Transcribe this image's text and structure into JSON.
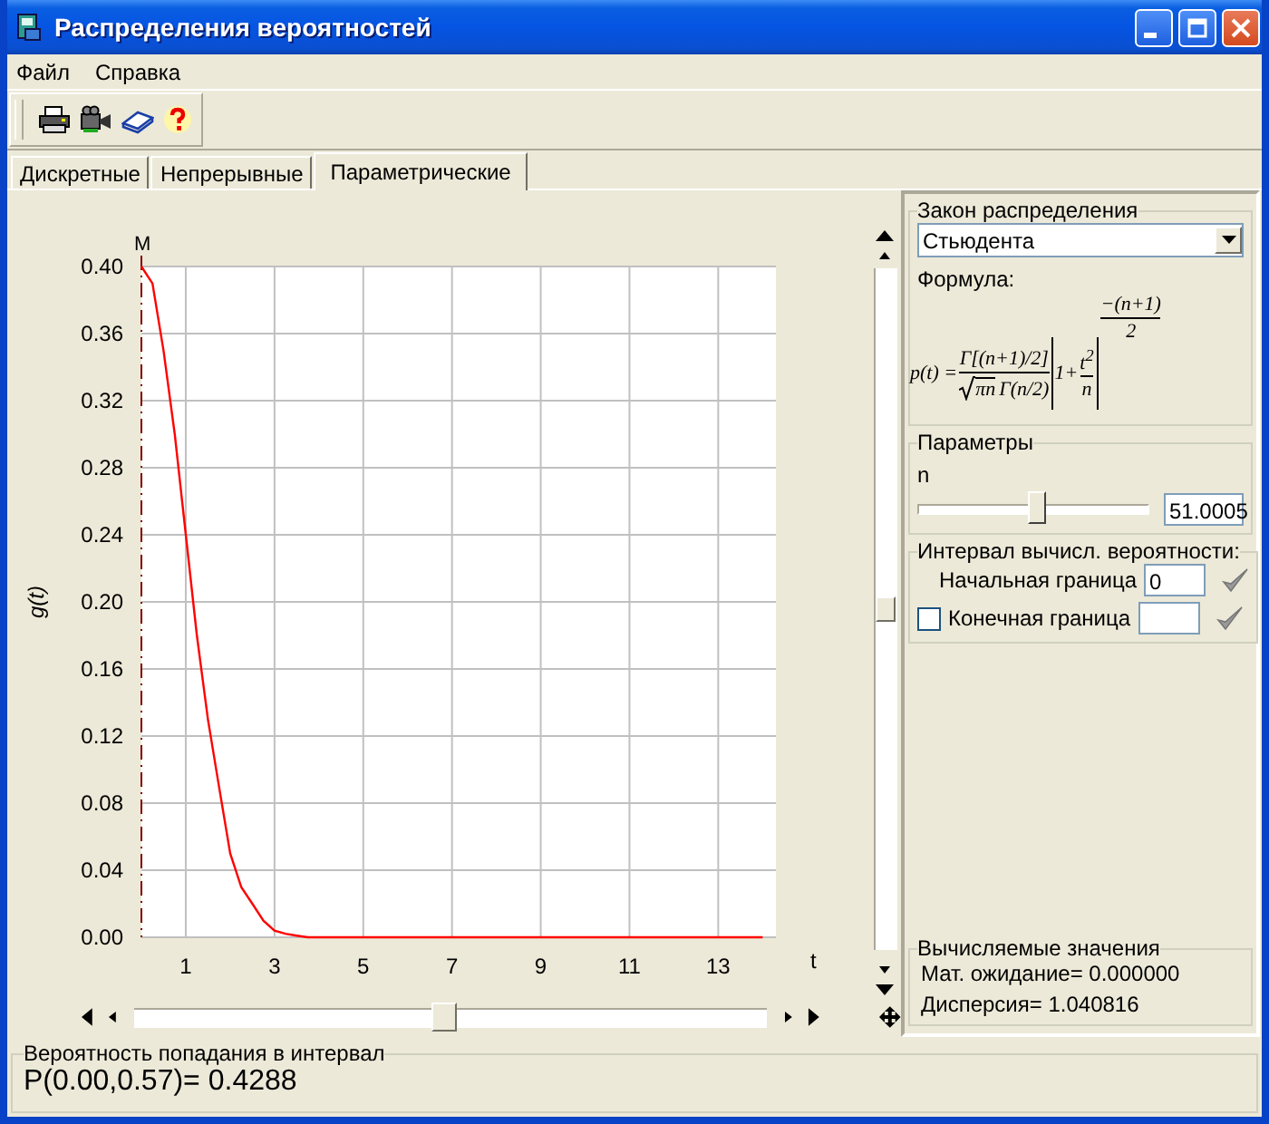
{
  "window": {
    "title": "Распределения вероятностей"
  },
  "menu": [
    "Файл",
    "Справка"
  ],
  "toolbar": [
    {
      "kind": "print"
    },
    {
      "kind": "camera"
    },
    {
      "kind": "book"
    },
    {
      "kind": "help"
    }
  ],
  "tabs": [
    {
      "label": "Дискретные",
      "selected": false
    },
    {
      "label": "Непрерывные",
      "selected": false
    },
    {
      "label": "Параметрические",
      "selected": true
    }
  ],
  "chart": {
    "chart_data": {
      "type": "line",
      "xlabel": "t",
      "ylabel": "g(t)",
      "xlim": [
        0,
        14.3
      ],
      "ylim": [
        0,
        0.4
      ],
      "xticks": [
        1,
        3,
        5,
        7,
        9,
        11,
        13
      ],
      "yticks": [
        {
          "value": 0,
          "label": "0.00"
        },
        {
          "value": 0.04,
          "label": "0.04"
        },
        {
          "value": 0.08,
          "label": "0.08"
        },
        {
          "value": 0.12,
          "label": "0.12"
        },
        {
          "value": 0.16,
          "label": "0.16"
        },
        {
          "value": 0.2,
          "label": "0.20"
        },
        {
          "value": 0.24,
          "label": "0.24"
        },
        {
          "value": 0.28,
          "label": "0.28"
        },
        {
          "value": 0.32,
          "label": "0.32"
        },
        {
          "value": 0.36,
          "label": "0.36"
        },
        {
          "value": 0.4,
          "label": "0.40"
        }
      ],
      "x": [
        0,
        0.25,
        0.5,
        0.75,
        1,
        1.25,
        1.5,
        1.75,
        2,
        2.25,
        2.5,
        2.75,
        3,
        3.25,
        3.5,
        3.75,
        4,
        5,
        6,
        7,
        8,
        9,
        10,
        11,
        12,
        13,
        14
      ],
      "series": [
        {
          "color": "#ff0000",
          "values": [
            0.4,
            0.39,
            0.35,
            0.3,
            0.24,
            0.18,
            0.13,
            0.09,
            0.05,
            0.03,
            0.02,
            0.01,
            0.004,
            0.002,
            0.001,
            0,
            0,
            0,
            0,
            0,
            0,
            0,
            0,
            0,
            0,
            0,
            0
          ]
        }
      ],
      "grid": true
    },
    "mean_marker": {
      "label": "M"
    },
    "vertical_scroll": {
      "level": 0.5
    },
    "horizontal_scroll": {
      "level": 0.49
    }
  },
  "distribution": {
    "title": "Закон распределения",
    "value": "Стьюдента",
    "formula_label": "Формула:",
    "formula": {
      "lhs": "p(t) =",
      "num": "Γ[(n+1)/2]",
      "den_root": "πn",
      "den": "Γ(n/2)",
      "lead": "1+",
      "inner_num": "t",
      "inner_exp": "2",
      "inner_den": "n",
      "exp_num": "−(n+1)",
      "exp_den": "2"
    }
  },
  "parameters": {
    "title": "Параметры",
    "name": "n",
    "level": 0.52,
    "value": "51.0005"
  },
  "interval": {
    "title": "Интервал вычисл. вероятности:",
    "start": {
      "label": "Начальная граница",
      "value": "0"
    },
    "end": {
      "label": "Конечная граница",
      "checked": false
    }
  },
  "computed": {
    "title": "Вычисляемые значения",
    "lines": [
      "Мат. ожидание= 0.000000",
      "Дисперсия= 1.040816"
    ]
  },
  "probability": {
    "title": "Вероятность попадания в интервал",
    "value": "P(0.00,0.57)= 0.4288"
  }
}
